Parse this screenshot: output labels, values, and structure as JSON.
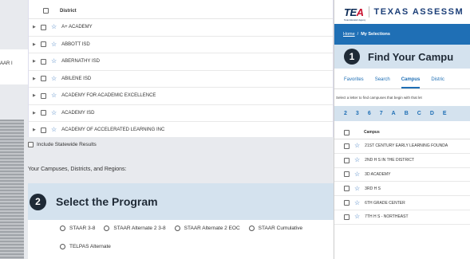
{
  "left": {
    "background_text": "AAR I",
    "district_header": "District",
    "districts": [
      "A+ ACADEMY",
      "ABBOTT ISD",
      "ABERNATHY ISD",
      "ABILENE ISD",
      "ACADEMY FOR ACADEMIC EXCELLENCE",
      "ACADEMY ISD",
      "ACADEMY OF ACCELERATED LEARNING INC"
    ],
    "statewide_label": "Include Statewide Results",
    "your_campuses_label": "Your Campuses, Districts, and Regions:",
    "program_step": "2",
    "program_title": "Select the Program",
    "program_options_row1": [
      "STAAR 3-8",
      "STAAR Alternate 2 3-8",
      "STAAR Alternate 2 EOC",
      "STAAR Cumulative"
    ],
    "program_options_row2": [
      "TELPAS Alternate"
    ]
  },
  "right": {
    "logo_text_main": "TE",
    "logo_text_accent": "A",
    "logo_tagline": "Texas Education Agency",
    "app_title": "TEXAS ASSESSM",
    "breadcrumb": {
      "home": "Home",
      "separator": "/",
      "current": "My Selections"
    },
    "find_step": "1",
    "find_title": "Find Your Campu",
    "tabs": [
      {
        "label": "Favorites",
        "active": false
      },
      {
        "label": "Search",
        "active": false
      },
      {
        "label": "Campus",
        "active": true
      },
      {
        "label": "Distric",
        "active": false
      }
    ],
    "letter_hint": "Select a letter to find campuses that begin with that let",
    "letters": [
      "2",
      "3",
      "6",
      "7",
      "A",
      "B",
      "C",
      "D",
      "E"
    ],
    "campus_header": "Campus",
    "campuses": [
      "21ST CENTURY EARLY LEARNING FOUNDA",
      "2ND H S IN THE DISTRICT",
      "3D ACADEMY",
      "3RD H S",
      "6TH GRADE CENTER",
      "7TH H S - NORTHEAST"
    ]
  },
  "colors": {
    "brand_blue": "#1f6fb5",
    "band_light_blue": "#d4e2ee",
    "dark_navy": "#1f2a36",
    "tea_red": "#c8102e"
  }
}
